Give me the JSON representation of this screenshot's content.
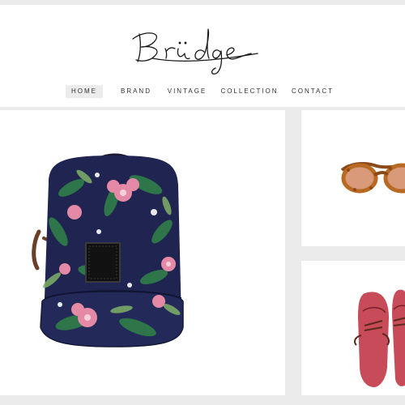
{
  "brand": {
    "logo_text": "Brüdge"
  },
  "nav": {
    "items": [
      {
        "label": "HOME",
        "active": true
      },
      {
        "label": "BRAND",
        "active": false
      },
      {
        "label": "VINTAGE",
        "active": false
      },
      {
        "label": "COLLECTION",
        "active": false
      },
      {
        "label": "CONTACT",
        "active": false
      }
    ]
  },
  "products": [
    {
      "name": "floral-backpack",
      "image_icon": "backpack-image"
    },
    {
      "name": "sunglasses",
      "image_icon": "sunglasses-image"
    },
    {
      "name": "red-shoes",
      "image_icon": "shoes-image"
    }
  ],
  "colors": {
    "background": "#ebebeb",
    "header": "#ffffff",
    "nav_active_bg": "#ececec",
    "text": "#333333",
    "backpack_navy": "#1f2450",
    "shoe_red": "#c84b5a",
    "glasses_tortoise": "#b86a22"
  }
}
